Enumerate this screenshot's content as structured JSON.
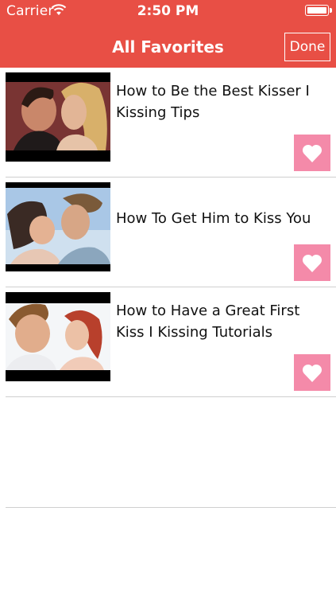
{
  "status_bar": {
    "carrier": "Carrier",
    "time": "2:50 PM"
  },
  "nav": {
    "title": "All Favorites",
    "done_label": "Done"
  },
  "favorites": [
    {
      "title": "How to Be the Best Kisser I Kissing Tips"
    },
    {
      "title": "How To Get Him to Kiss You"
    },
    {
      "title": "How to Have a Great First Kiss I Kissing Tutorials"
    }
  ],
  "colors": {
    "header": "#e84f45",
    "heart_button": "#f48aa9",
    "divider": "#cfcfcf"
  },
  "icons": {
    "wifi": "wifi-icon",
    "battery": "battery-icon",
    "heart": "heart-icon"
  }
}
